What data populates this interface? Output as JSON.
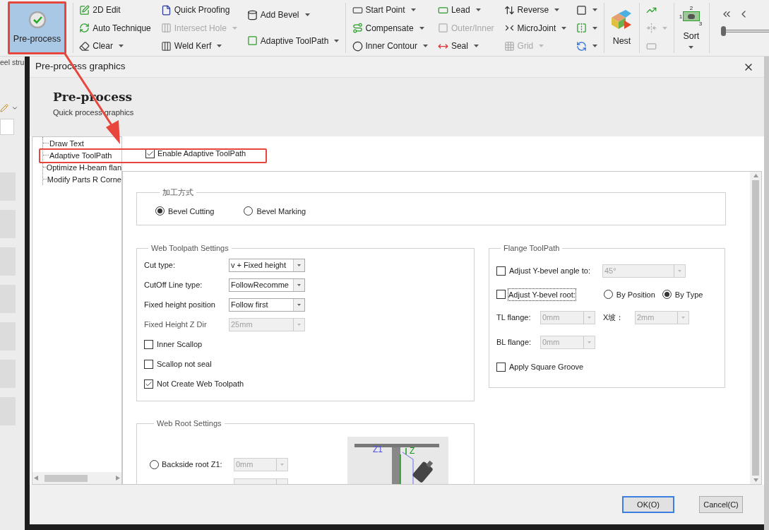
{
  "ribbon": {
    "groups": [
      {
        "kind": "large",
        "label": "Pre-process",
        "selected": true,
        "dropdown": false
      },
      {
        "kind": "columns",
        "columns": [
          [
            {
              "label": "2D Edit",
              "dropdown": false,
              "disabled": false
            },
            {
              "label": "Auto Technique",
              "dropdown": false,
              "disabled": false
            },
            {
              "label": "Clear",
              "dropdown": true,
              "disabled": false
            }
          ],
          [
            {
              "label": "Quick Proofing",
              "dropdown": false,
              "disabled": false
            },
            {
              "label": "Intersect Hole",
              "dropdown": true,
              "disabled": true
            },
            {
              "label": "Weld Kerf",
              "dropdown": true,
              "disabled": false
            }
          ],
          [
            {
              "label": "Add Bevel",
              "dropdown": true,
              "disabled": false
            },
            {
              "label": "Adaptive ToolPath",
              "dropdown": true,
              "disabled": false
            }
          ]
        ]
      },
      {
        "kind": "columns",
        "columns": [
          [
            {
              "label": "Start Point",
              "dropdown": true,
              "disabled": false
            },
            {
              "label": "Compensate",
              "dropdown": true,
              "disabled": false
            },
            {
              "label": "Inner Contour",
              "dropdown": true,
              "disabled": false
            }
          ],
          [
            {
              "label": "Lead",
              "dropdown": true,
              "disabled": false
            },
            {
              "label": "Outer/Inner",
              "dropdown": false,
              "disabled": true
            },
            {
              "label": "Seal",
              "dropdown": true,
              "disabled": false
            }
          ],
          [
            {
              "label": "Reverse",
              "dropdown": true,
              "disabled": false
            },
            {
              "label": "MicroJoint",
              "dropdown": true,
              "disabled": false
            },
            {
              "label": "Grid",
              "dropdown": true,
              "disabled": true
            }
          ],
          [
            {
              "dropdown": true,
              "disabled": false
            },
            {
              "dropdown": true,
              "disabled": false
            },
            {
              "dropdown": true,
              "disabled": false
            }
          ]
        ]
      },
      {
        "kind": "large",
        "label": "Nest",
        "selected": false,
        "dropdown": false
      },
      {
        "kind": "columns",
        "columns": [
          [
            {
              "dropdown": false,
              "disabled": false
            },
            {
              "dropdown": true,
              "disabled": true
            },
            {
              "dropdown": false,
              "disabled": true
            }
          ]
        ]
      },
      {
        "kind": "large",
        "label": "Sort",
        "selected": false,
        "dropdown": true,
        "markers": [
          "2",
          "1",
          "3"
        ]
      },
      {
        "kind": "player",
        "level": 0
      }
    ]
  },
  "background_app": {
    "tab_text": "eel stru"
  },
  "dialog": {
    "title": "Pre-process graphics",
    "heading": "Pre-process",
    "subheading": "Quick process graphics",
    "tree": [
      {
        "label": "Draw Text",
        "selected": false
      },
      {
        "label": "Adaptive ToolPath",
        "selected": false
      },
      {
        "label": "Optimize H-beam flan",
        "selected": false
      },
      {
        "label": "Modify Parts R Corne",
        "selected": false
      }
    ],
    "enable": {
      "label": "Enable Adaptive ToolPath",
      "checked": true
    },
    "process_mode": {
      "title": "加工方式",
      "options": [
        {
          "label": "Bevel Cutting",
          "selected": true
        },
        {
          "label": "Bevel Marking",
          "selected": false
        }
      ]
    },
    "web_toolpath": {
      "title": "Web Toolpath Settings",
      "fields": [
        {
          "label": "Cut type:",
          "value": "v + Fixed height",
          "disabled": false
        },
        {
          "label": "CutOff Line type:",
          "value": "FollowRecomme",
          "disabled": false
        },
        {
          "label": "Fixed height position",
          "value": "Follow first",
          "disabled": false
        },
        {
          "label": "Fixed Height Z Dir",
          "value": "25mm",
          "disabled": true
        }
      ],
      "checks": [
        {
          "label": "Inner Scallop",
          "checked": false
        },
        {
          "label": "Scallop not seal",
          "checked": false
        },
        {
          "label": "Not Create Web Toolpath",
          "checked": true
        }
      ]
    },
    "flange": {
      "title": "Flange ToolPath",
      "angle": {
        "label": "Adjust Y-bevel angle to:",
        "checked": false,
        "value": "45°",
        "disabled": true
      },
      "root": {
        "label": "Adjust Y-bevel root:",
        "checked": false,
        "focused": true,
        "options": [
          {
            "label": "By Position",
            "selected": false
          },
          {
            "label": "By Type",
            "selected": true
          }
        ]
      },
      "tl": {
        "label": "TL flange:",
        "value": "0mm",
        "disabled": true
      },
      "x": {
        "label": "X坡：",
        "value": "2mm",
        "disabled": true
      },
      "bl": {
        "label": "BL flange:",
        "value": "0mm",
        "disabled": true
      },
      "square": {
        "label": "Apply Square Groove",
        "checked": false
      }
    },
    "web_root": {
      "title": "Web Root Settings",
      "backside": {
        "label": "Backside root Z1:",
        "selected": false,
        "value": "0mm",
        "disabled": true
      },
      "diagram": {
        "labels": [
          "Z1",
          "Z"
        ]
      }
    },
    "buttons": [
      {
        "label": "OK(O)",
        "focused": true
      },
      {
        "label": "Cancel(C)",
        "focused": false
      }
    ]
  }
}
